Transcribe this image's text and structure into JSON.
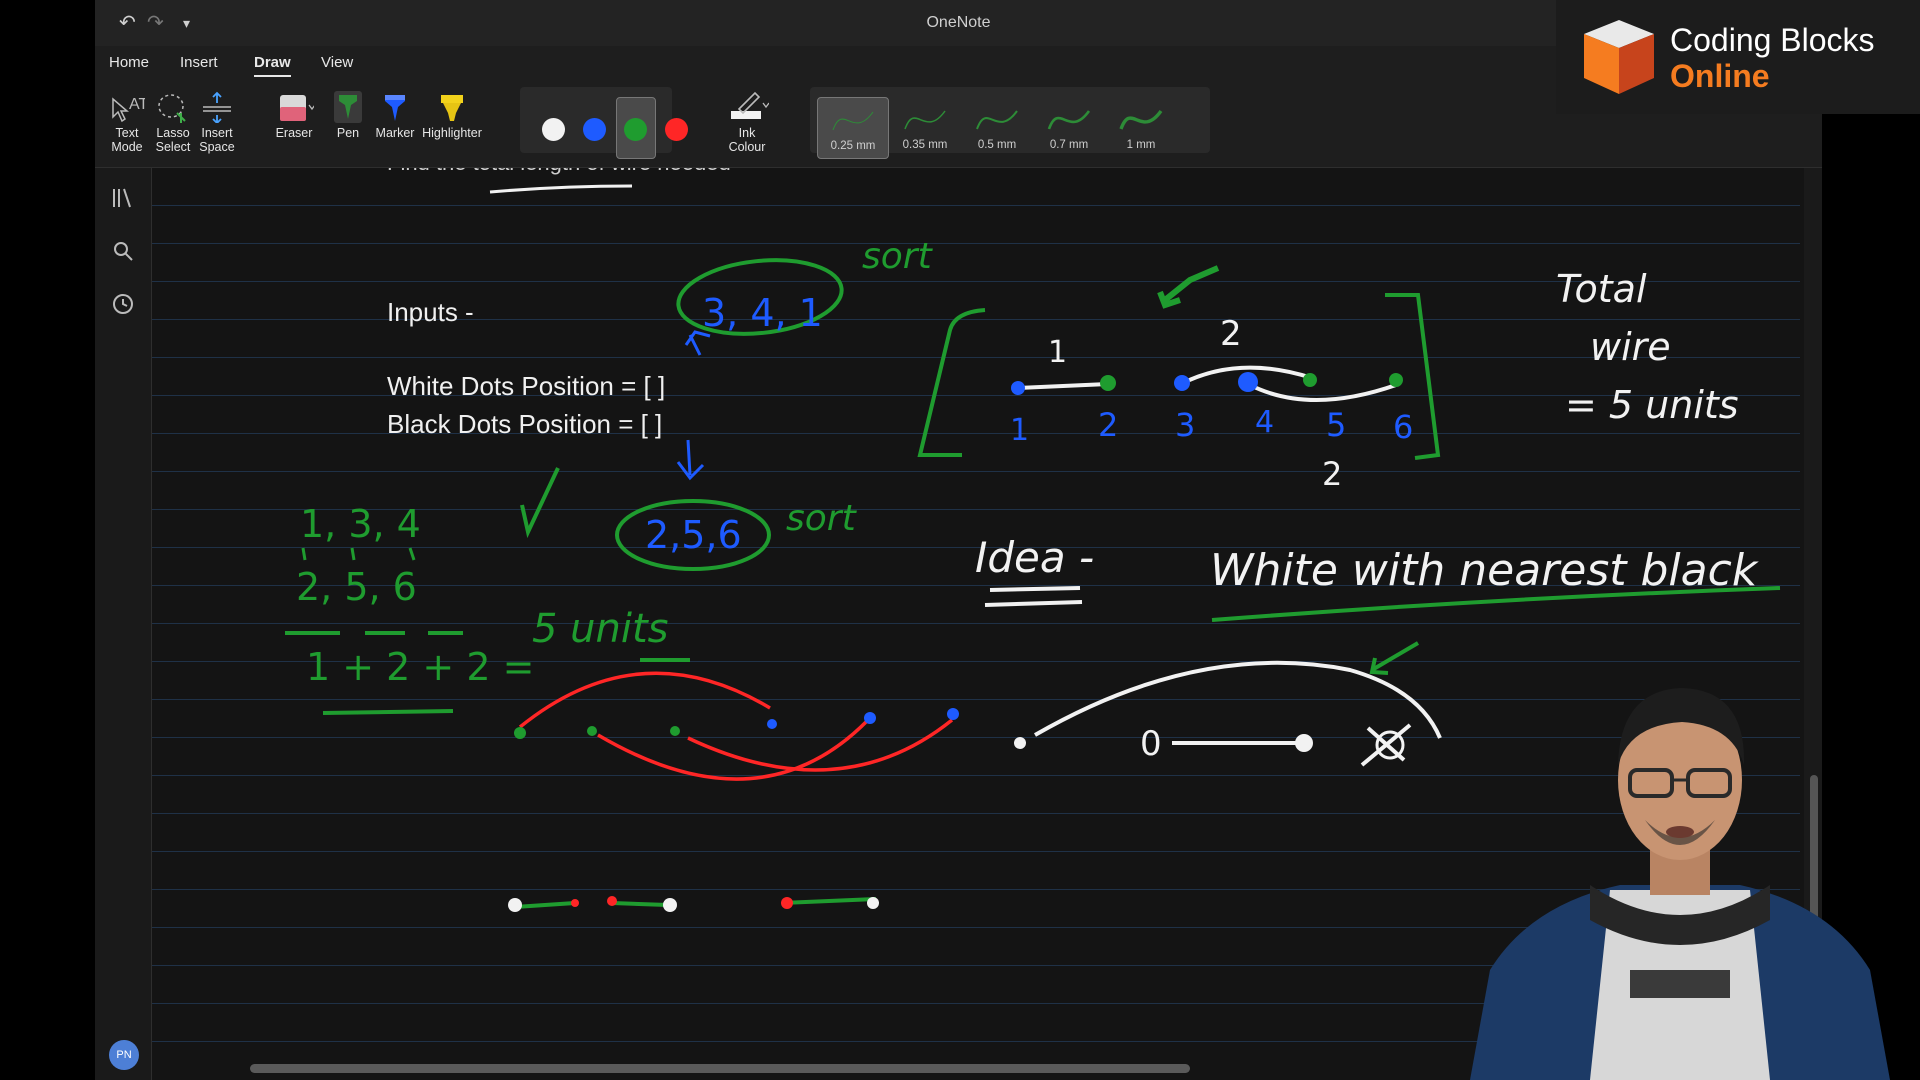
{
  "window": {
    "title": "OneNote",
    "undo_glyph": "↶",
    "redo_glyph": "↷",
    "customize_glyph": "▾"
  },
  "menu": {
    "tabs": [
      "Home",
      "Insert",
      "Draw",
      "View"
    ],
    "active_tab": "Draw"
  },
  "ribbon": {
    "text_mode": [
      "Text",
      "Mode"
    ],
    "lasso_select": [
      "Lasso",
      "Select"
    ],
    "insert_space": [
      "Insert",
      "Space"
    ],
    "eraser": "Eraser",
    "pen": "Pen",
    "marker": "Marker",
    "highlighter": "Highlighter",
    "ink_colour": [
      "Ink",
      "Colour"
    ],
    "colors": [
      "#f2f2f2",
      "#1e5bff",
      "#1f9c2f",
      "#ff2626"
    ],
    "selected_color": "#1f9c2f",
    "thicknesses": [
      "0.25 mm",
      "0.35 mm",
      "0.5 mm",
      "0.7 mm",
      "1 mm"
    ],
    "selected_thickness": "0.25 mm"
  },
  "sidebar": {
    "icons": [
      "notebooks-icon",
      "search-icon",
      "recent-icon"
    ],
    "avatar_initials": "PN"
  },
  "note": {
    "cut_off_heading": "Find the total length of wire needed",
    "inputs_label": "Inputs -",
    "white_dots_line": "White Dots Position =  [ ]",
    "black_dots_line": "Black Dots Position = [  ]"
  },
  "ink_text": {
    "sort_top": "sort",
    "sorted_white": "3, 4, 1",
    "sorted_black": "2,5,6",
    "sort_bottom": "sort",
    "list_top": "1, 3, 4",
    "list_bottom": "2, 5, 6",
    "sum": "1 + 2 + 2 =",
    "five_units": "5 units",
    "diagram_top_1": "1",
    "diagram_top_2": "2",
    "diagram_bottom_2": "2",
    "diagram_nums": [
      "1",
      "2",
      "3",
      "4",
      "5",
      "6"
    ],
    "total_line1": "Total",
    "total_line2": "wire",
    "total_line3": "= 5 units",
    "idea": "Idea -",
    "strategy": "White with nearest black",
    "cross_zero": "0"
  },
  "logo": {
    "line1": "Coding Blocks",
    "line2": "Online",
    "colors": [
      "#f57c20",
      "#e9e9e9",
      "#c7441c"
    ]
  },
  "presenter_icon": "presenter-webcam-icon"
}
